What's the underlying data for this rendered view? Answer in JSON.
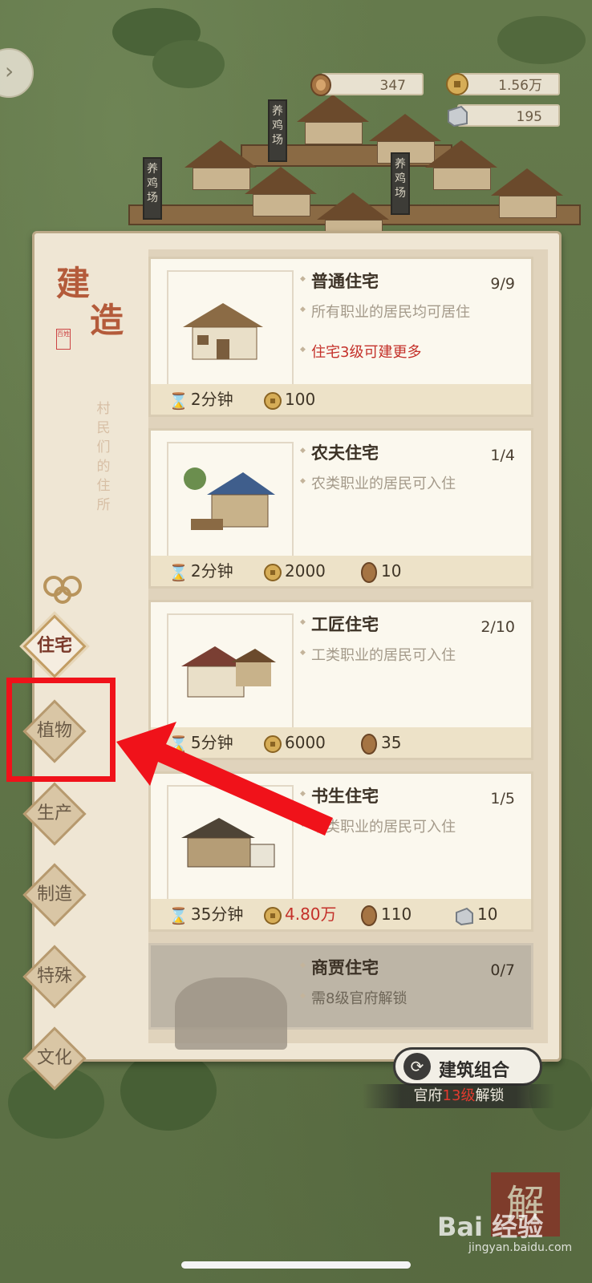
{
  "resources": {
    "wood": "347",
    "coins": "1.56万",
    "stone": "195"
  },
  "scene_banners": [
    "养鸡场",
    "养鸡场",
    "养鸡场"
  ],
  "panel": {
    "title": "建造",
    "seal_text": "百姓",
    "subtitle": "村民们的住所"
  },
  "categories": [
    {
      "label": "住宅",
      "active": true
    },
    {
      "label": "植物",
      "active": false
    },
    {
      "label": "生产",
      "active": false
    },
    {
      "label": "制造",
      "active": false
    },
    {
      "label": "特殊",
      "active": false
    },
    {
      "label": "文化",
      "active": false
    }
  ],
  "buildings": [
    {
      "name": "普通住宅",
      "count": "9/9",
      "desc": "所有职业的居民均可居住",
      "upgrade_note": "住宅3级可建更多",
      "time": "2分钟",
      "coin": "100",
      "wood": "",
      "stone": ""
    },
    {
      "name": "农夫住宅",
      "count": "1/4",
      "desc": "农类职业的居民可入住",
      "time": "2分钟",
      "coin": "2000",
      "wood": "10",
      "stone": ""
    },
    {
      "name": "工匠住宅",
      "count": "2/10",
      "desc": "工类职业的居民可入住",
      "time": "5分钟",
      "coin": "6000",
      "wood": "35",
      "stone": ""
    },
    {
      "name": "书生住宅",
      "count": "1/5",
      "desc": "书类职业的居民可入住",
      "time": "35分钟",
      "coin": "4.80万",
      "coin_insufficient": true,
      "wood": "110",
      "stone": "10"
    },
    {
      "name": "商贾住宅",
      "count": "0/7",
      "desc": "需8级官府解锁",
      "locked": true
    }
  ],
  "combo": {
    "label": "建筑组合",
    "unlock_prefix": "官府",
    "unlock_level": "13级",
    "unlock_suffix": "解锁"
  },
  "watermark": {
    "text": "Bai 经验",
    "sub": "jingyan.baidu.com",
    "seal": "解"
  },
  "colors": {
    "accent_red": "#c4312a",
    "annotation_red": "#f0121a",
    "panel_bg": "#efe6d4"
  }
}
